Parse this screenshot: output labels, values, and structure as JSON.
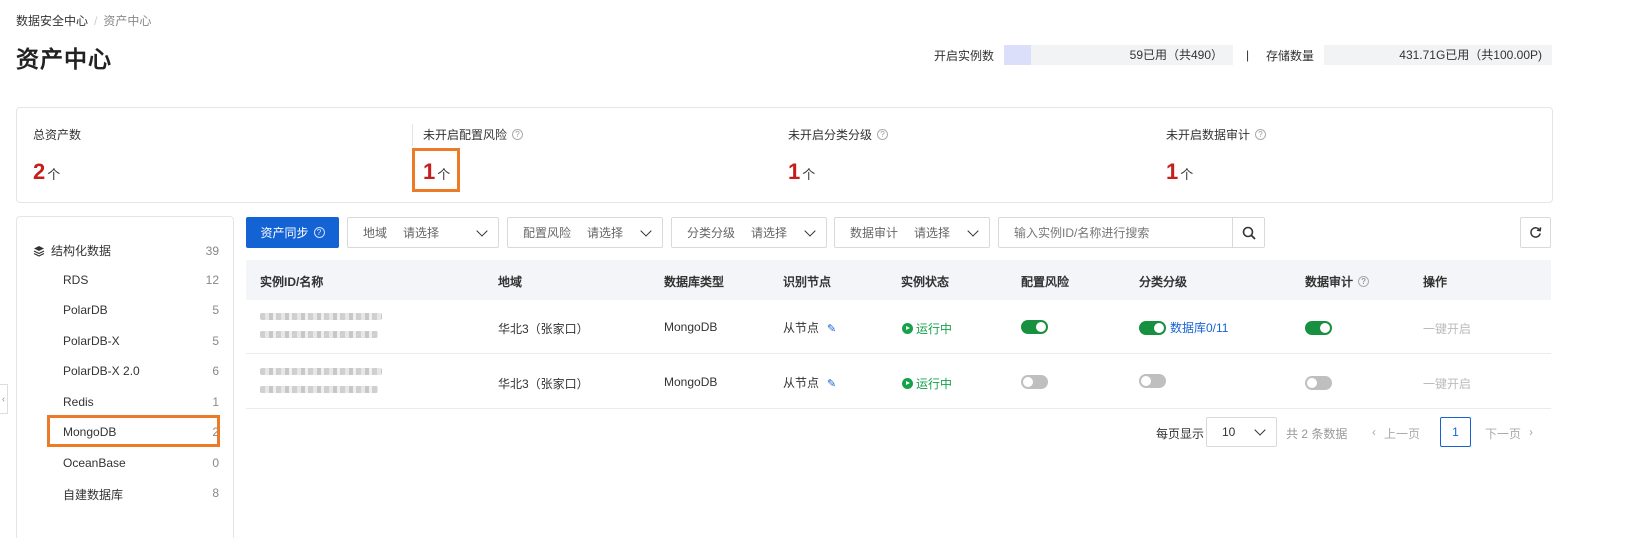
{
  "breadcrumb": {
    "root": "数据安全中心",
    "separator": "/",
    "current": "资产中心"
  },
  "page_title": "资产中心",
  "quota": {
    "instances_label": "开启实例数",
    "instances_text": "59已用（共490）",
    "instances_used_fraction": 0.12,
    "separator": "|",
    "storage_label": "存储数量",
    "storage_text": "431.71G已用（共100.00P)",
    "storage_used_fraction": 0.0
  },
  "summary": [
    {
      "label": "总资产数",
      "value": "2",
      "unit": "个",
      "help": false
    },
    {
      "label": "未开启配置风险",
      "value": "1",
      "unit": "个",
      "help": true
    },
    {
      "label": "未开启分类分级",
      "value": "1",
      "unit": "个",
      "help": true
    },
    {
      "label": "未开启数据审计",
      "value": "1",
      "unit": "个",
      "help": true
    }
  ],
  "sidebar": {
    "group_label": "结构化数据",
    "group_count": "39",
    "items": [
      {
        "label": "RDS",
        "count": "12"
      },
      {
        "label": "PolarDB",
        "count": "5"
      },
      {
        "label": "PolarDB-X",
        "count": "5"
      },
      {
        "label": "PolarDB-X 2.0",
        "count": "6"
      },
      {
        "label": "Redis",
        "count": "1"
      },
      {
        "label": "MongoDB",
        "count": "2"
      },
      {
        "label": "OceanBase",
        "count": "0"
      },
      {
        "label": "自建数据库",
        "count": "8"
      }
    ]
  },
  "toolbar": {
    "sync_label": "资产同步",
    "filters": [
      {
        "label": "地域",
        "value": "请选择"
      },
      {
        "label": "配置风险",
        "value": "请选择"
      },
      {
        "label": "分类分级",
        "value": "请选择"
      },
      {
        "label": "数据审计",
        "value": "请选择"
      }
    ],
    "search_placeholder": "输入实例ID/名称进行搜索",
    "search_icon": "search-icon",
    "refresh_icon": "refresh-icon"
  },
  "table": {
    "headers": {
      "id": "实例ID/名称",
      "region": "地域",
      "db_type": "数据库类型",
      "node": "识别节点",
      "status": "实例状态",
      "config_risk": "配置风险",
      "classify": "分类分级",
      "audit": "数据审计",
      "action": "操作"
    },
    "rows": [
      {
        "region": "华北3（张家口）",
        "db_type": "MongoDB",
        "node": "从节点",
        "status": "运行中",
        "config_risk_on": true,
        "classify_on": true,
        "classify_link": "数据库0/11",
        "audit_on": true,
        "action": "一键开启"
      },
      {
        "region": "华北3（张家口）",
        "db_type": "MongoDB",
        "node": "从节点",
        "status": "运行中",
        "config_risk_on": false,
        "classify_on": false,
        "classify_link": "",
        "audit_on": false,
        "action": "一键开启"
      }
    ]
  },
  "pagination": {
    "per_page_label": "每页显示",
    "per_page_value": "10",
    "total_text": "共 2 条数据",
    "prev_label": "上一页",
    "current_page": "1",
    "next_label": "下一页"
  },
  "colors": {
    "primary": "#1463d5",
    "danger": "#c81d1d",
    "highlight": "#ec7b27",
    "success": "#16a14b"
  }
}
